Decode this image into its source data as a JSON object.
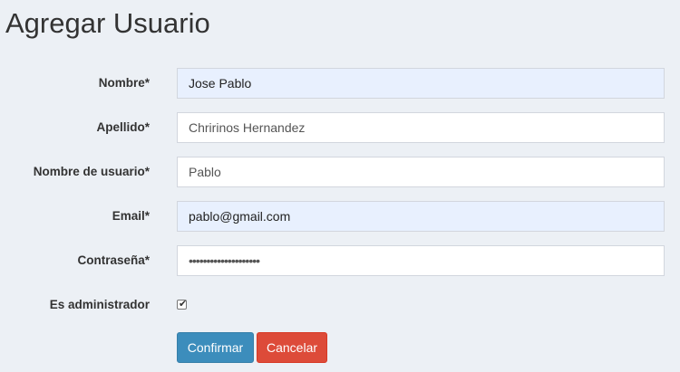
{
  "page": {
    "title": "Agregar Usuario"
  },
  "form": {
    "fields": [
      {
        "label": "Nombre*",
        "value": "Jose Pablo"
      },
      {
        "label": "Apellido*",
        "value": "Chririnos Hernandez"
      },
      {
        "label": "Nombre de usuario*",
        "value": "Pablo"
      },
      {
        "label": "Email*",
        "value": "pablo@gmail.com"
      },
      {
        "label": "Contraseña*",
        "value": "••••••••••••••••••••"
      }
    ],
    "admin": {
      "label": "Es administrador",
      "checked": true
    }
  },
  "actions": {
    "confirm_label": "Confirmar",
    "cancel_label": "Cancelar"
  },
  "colors": {
    "background": "#ecf0f5",
    "primary": "#3c8dbc",
    "danger": "#dd4b39",
    "autofill": "#e8f0fe"
  }
}
